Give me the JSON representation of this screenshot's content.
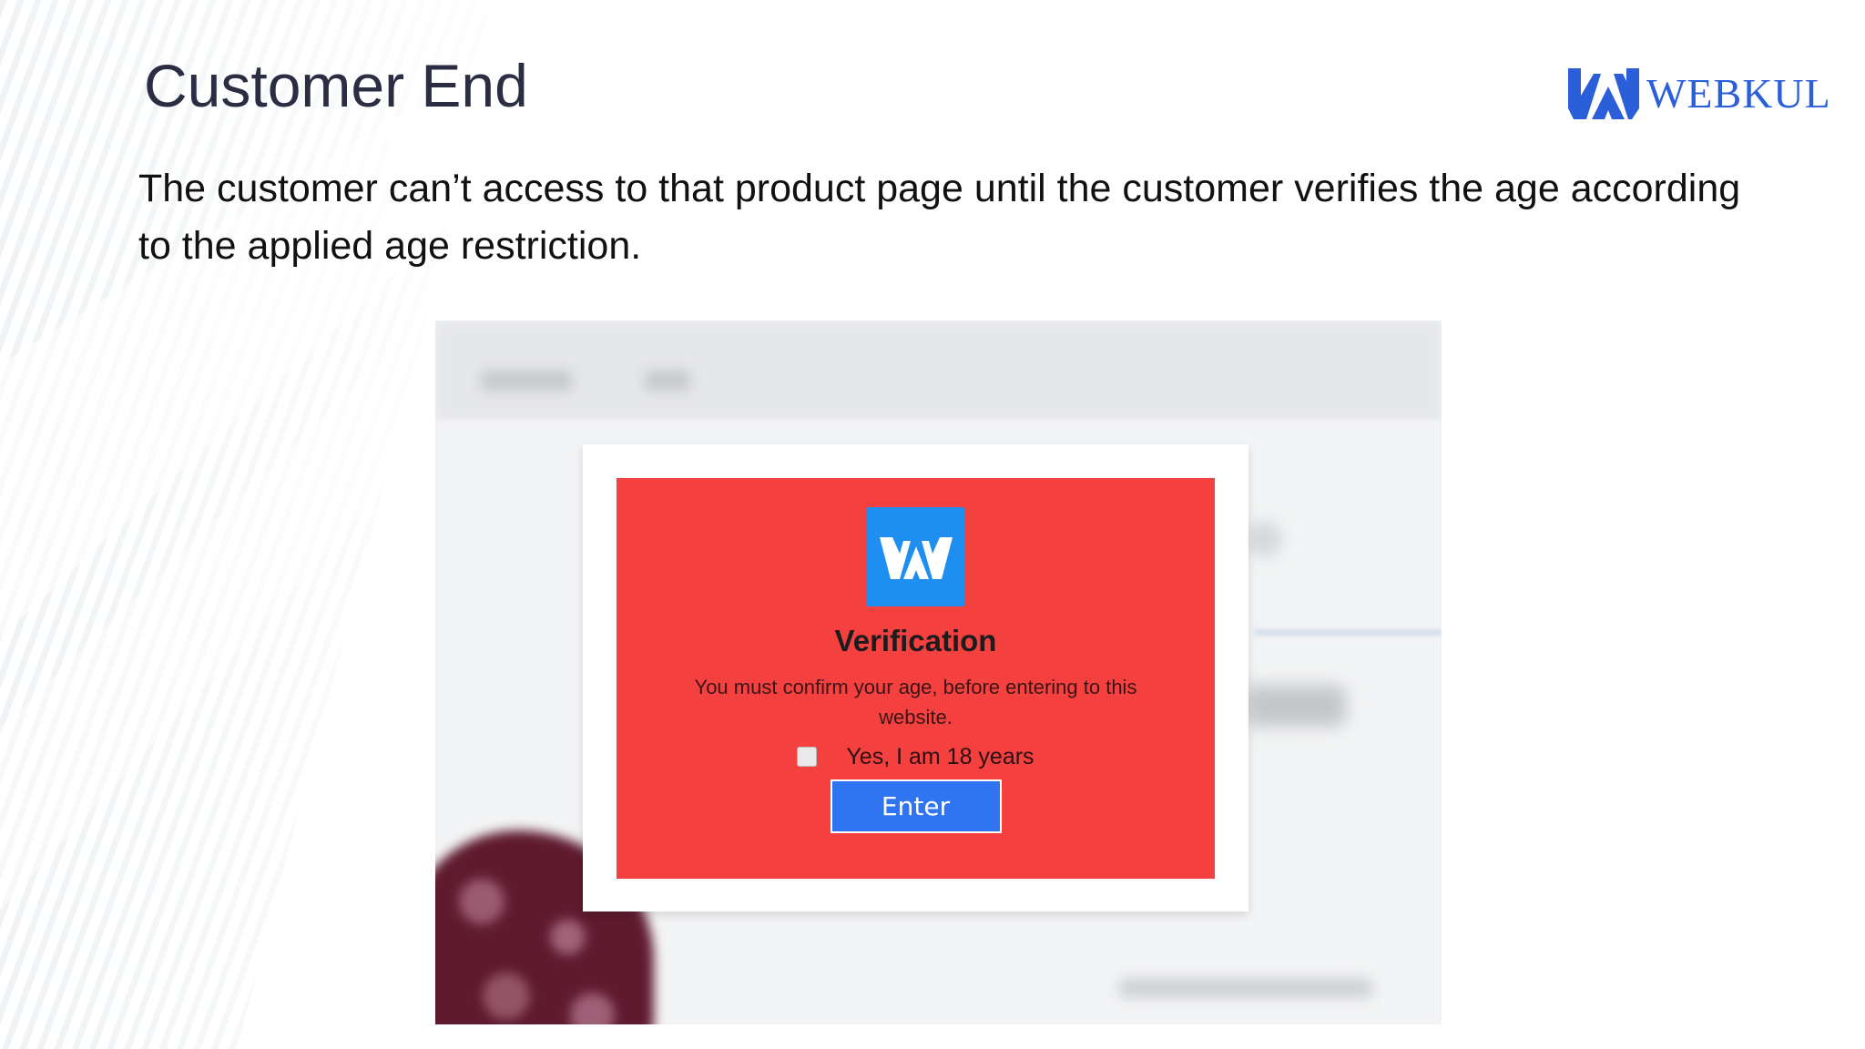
{
  "slide": {
    "title": "Customer End",
    "description": "The customer can’t access to that product page until the customer verifies the age according to the applied age restriction."
  },
  "brand": {
    "logo_text": "WEBKUL",
    "color": "#2b5fd9"
  },
  "verification_popup": {
    "title": "Verification",
    "message": "You must confirm your age, before entering to this website.",
    "checkbox_label": "Yes, I am 18 years",
    "checkbox_checked": false,
    "button_label": "Enter",
    "background_color": "#f54040",
    "button_color": "#2f74f0",
    "logo_color": "#1f8ef1"
  },
  "icons": {
    "brand_logo": "webkul-logo-icon",
    "popup_logo": "webkul-logo-icon"
  }
}
